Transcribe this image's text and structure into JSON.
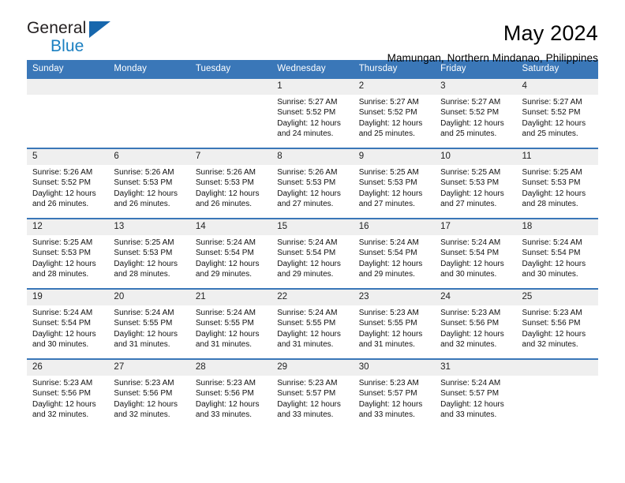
{
  "brand": {
    "line1": "General",
    "line2": "Blue",
    "accent_color": "#1a7fc1",
    "triangle_color": "#1767ad"
  },
  "header": {
    "title": "May 2024",
    "subtitle": "Mamungan, Northern Mindanao, Philippines",
    "header_bg": "#3a77b8",
    "daynum_bg": "#efefef"
  },
  "weekday_headers": [
    "Sunday",
    "Monday",
    "Tuesday",
    "Wednesday",
    "Thursday",
    "Friday",
    "Saturday"
  ],
  "labels": {
    "sunrise_prefix": "Sunrise:",
    "sunset_prefix": "Sunset:",
    "daylight_prefix": "Daylight:"
  },
  "weeks": [
    [
      {
        "day": "",
        "empty": true
      },
      {
        "day": "",
        "empty": true
      },
      {
        "day": "",
        "empty": true
      },
      {
        "day": "1",
        "sunrise": "Sunrise: 5:27 AM",
        "sunset": "Sunset: 5:52 PM",
        "daylight1": "Daylight: 12 hours",
        "daylight2": "and 24 minutes."
      },
      {
        "day": "2",
        "sunrise": "Sunrise: 5:27 AM",
        "sunset": "Sunset: 5:52 PM",
        "daylight1": "Daylight: 12 hours",
        "daylight2": "and 25 minutes."
      },
      {
        "day": "3",
        "sunrise": "Sunrise: 5:27 AM",
        "sunset": "Sunset: 5:52 PM",
        "daylight1": "Daylight: 12 hours",
        "daylight2": "and 25 minutes."
      },
      {
        "day": "4",
        "sunrise": "Sunrise: 5:27 AM",
        "sunset": "Sunset: 5:52 PM",
        "daylight1": "Daylight: 12 hours",
        "daylight2": "and 25 minutes."
      }
    ],
    [
      {
        "day": "5",
        "sunrise": "Sunrise: 5:26 AM",
        "sunset": "Sunset: 5:52 PM",
        "daylight1": "Daylight: 12 hours",
        "daylight2": "and 26 minutes."
      },
      {
        "day": "6",
        "sunrise": "Sunrise: 5:26 AM",
        "sunset": "Sunset: 5:53 PM",
        "daylight1": "Daylight: 12 hours",
        "daylight2": "and 26 minutes."
      },
      {
        "day": "7",
        "sunrise": "Sunrise: 5:26 AM",
        "sunset": "Sunset: 5:53 PM",
        "daylight1": "Daylight: 12 hours",
        "daylight2": "and 26 minutes."
      },
      {
        "day": "8",
        "sunrise": "Sunrise: 5:26 AM",
        "sunset": "Sunset: 5:53 PM",
        "daylight1": "Daylight: 12 hours",
        "daylight2": "and 27 minutes."
      },
      {
        "day": "9",
        "sunrise": "Sunrise: 5:25 AM",
        "sunset": "Sunset: 5:53 PM",
        "daylight1": "Daylight: 12 hours",
        "daylight2": "and 27 minutes."
      },
      {
        "day": "10",
        "sunrise": "Sunrise: 5:25 AM",
        "sunset": "Sunset: 5:53 PM",
        "daylight1": "Daylight: 12 hours",
        "daylight2": "and 27 minutes."
      },
      {
        "day": "11",
        "sunrise": "Sunrise: 5:25 AM",
        "sunset": "Sunset: 5:53 PM",
        "daylight1": "Daylight: 12 hours",
        "daylight2": "and 28 minutes."
      }
    ],
    [
      {
        "day": "12",
        "sunrise": "Sunrise: 5:25 AM",
        "sunset": "Sunset: 5:53 PM",
        "daylight1": "Daylight: 12 hours",
        "daylight2": "and 28 minutes."
      },
      {
        "day": "13",
        "sunrise": "Sunrise: 5:25 AM",
        "sunset": "Sunset: 5:53 PM",
        "daylight1": "Daylight: 12 hours",
        "daylight2": "and 28 minutes."
      },
      {
        "day": "14",
        "sunrise": "Sunrise: 5:24 AM",
        "sunset": "Sunset: 5:54 PM",
        "daylight1": "Daylight: 12 hours",
        "daylight2": "and 29 minutes."
      },
      {
        "day": "15",
        "sunrise": "Sunrise: 5:24 AM",
        "sunset": "Sunset: 5:54 PM",
        "daylight1": "Daylight: 12 hours",
        "daylight2": "and 29 minutes."
      },
      {
        "day": "16",
        "sunrise": "Sunrise: 5:24 AM",
        "sunset": "Sunset: 5:54 PM",
        "daylight1": "Daylight: 12 hours",
        "daylight2": "and 29 minutes."
      },
      {
        "day": "17",
        "sunrise": "Sunrise: 5:24 AM",
        "sunset": "Sunset: 5:54 PM",
        "daylight1": "Daylight: 12 hours",
        "daylight2": "and 30 minutes."
      },
      {
        "day": "18",
        "sunrise": "Sunrise: 5:24 AM",
        "sunset": "Sunset: 5:54 PM",
        "daylight1": "Daylight: 12 hours",
        "daylight2": "and 30 minutes."
      }
    ],
    [
      {
        "day": "19",
        "sunrise": "Sunrise: 5:24 AM",
        "sunset": "Sunset: 5:54 PM",
        "daylight1": "Daylight: 12 hours",
        "daylight2": "and 30 minutes."
      },
      {
        "day": "20",
        "sunrise": "Sunrise: 5:24 AM",
        "sunset": "Sunset: 5:55 PM",
        "daylight1": "Daylight: 12 hours",
        "daylight2": "and 31 minutes."
      },
      {
        "day": "21",
        "sunrise": "Sunrise: 5:24 AM",
        "sunset": "Sunset: 5:55 PM",
        "daylight1": "Daylight: 12 hours",
        "daylight2": "and 31 minutes."
      },
      {
        "day": "22",
        "sunrise": "Sunrise: 5:24 AM",
        "sunset": "Sunset: 5:55 PM",
        "daylight1": "Daylight: 12 hours",
        "daylight2": "and 31 minutes."
      },
      {
        "day": "23",
        "sunrise": "Sunrise: 5:23 AM",
        "sunset": "Sunset: 5:55 PM",
        "daylight1": "Daylight: 12 hours",
        "daylight2": "and 31 minutes."
      },
      {
        "day": "24",
        "sunrise": "Sunrise: 5:23 AM",
        "sunset": "Sunset: 5:56 PM",
        "daylight1": "Daylight: 12 hours",
        "daylight2": "and 32 minutes."
      },
      {
        "day": "25",
        "sunrise": "Sunrise: 5:23 AM",
        "sunset": "Sunset: 5:56 PM",
        "daylight1": "Daylight: 12 hours",
        "daylight2": "and 32 minutes."
      }
    ],
    [
      {
        "day": "26",
        "sunrise": "Sunrise: 5:23 AM",
        "sunset": "Sunset: 5:56 PM",
        "daylight1": "Daylight: 12 hours",
        "daylight2": "and 32 minutes."
      },
      {
        "day": "27",
        "sunrise": "Sunrise: 5:23 AM",
        "sunset": "Sunset: 5:56 PM",
        "daylight1": "Daylight: 12 hours",
        "daylight2": "and 32 minutes."
      },
      {
        "day": "28",
        "sunrise": "Sunrise: 5:23 AM",
        "sunset": "Sunset: 5:56 PM",
        "daylight1": "Daylight: 12 hours",
        "daylight2": "and 33 minutes."
      },
      {
        "day": "29",
        "sunrise": "Sunrise: 5:23 AM",
        "sunset": "Sunset: 5:57 PM",
        "daylight1": "Daylight: 12 hours",
        "daylight2": "and 33 minutes."
      },
      {
        "day": "30",
        "sunrise": "Sunrise: 5:23 AM",
        "sunset": "Sunset: 5:57 PM",
        "daylight1": "Daylight: 12 hours",
        "daylight2": "and 33 minutes."
      },
      {
        "day": "31",
        "sunrise": "Sunrise: 5:24 AM",
        "sunset": "Sunset: 5:57 PM",
        "daylight1": "Daylight: 12 hours",
        "daylight2": "and 33 minutes."
      },
      {
        "day": "",
        "empty": true
      }
    ]
  ]
}
